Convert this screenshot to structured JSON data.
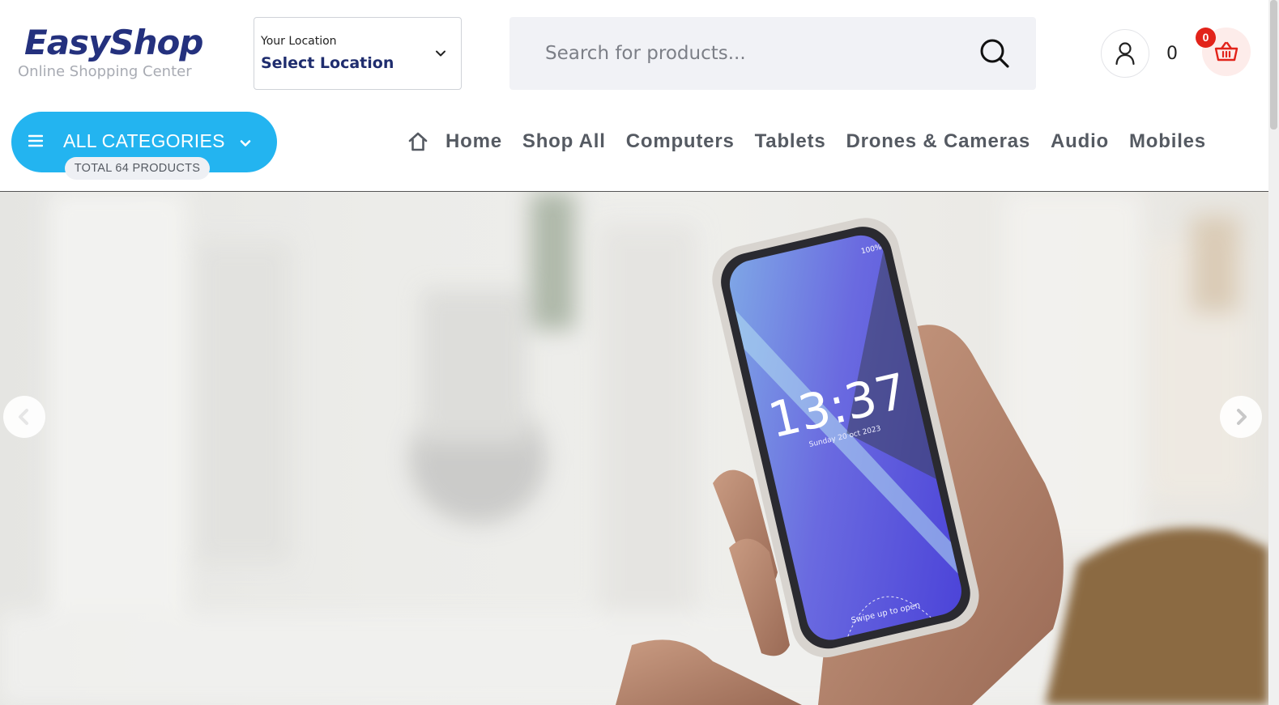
{
  "brand": {
    "name": "EasyShop",
    "tagline": "Online Shopping Center"
  },
  "location": {
    "label": "Your Location",
    "value": "Select Location",
    "icon": "chevron-down-icon"
  },
  "search": {
    "placeholder": "Search for products...",
    "icon": "search-icon"
  },
  "account": {
    "icon": "user-icon"
  },
  "cart": {
    "total": "0",
    "count": "0",
    "icon": "basket-icon"
  },
  "categories": {
    "label": "ALL CATEGORIES",
    "count_label": "TOTAL 64 PRODUCTS",
    "icon": "hamburger-icon"
  },
  "nav": {
    "home_icon": "home-icon",
    "items": [
      {
        "label": "Home"
      },
      {
        "label": "Shop All"
      },
      {
        "label": "Computers"
      },
      {
        "label": "Tablets"
      },
      {
        "label": "Drones & Cameras"
      },
      {
        "label": "Audio"
      },
      {
        "label": "Mobiles"
      }
    ]
  },
  "hero": {
    "phone_time": "13:37",
    "phone_date": "Sunday 20 oct 2023",
    "phone_battery": "100%",
    "phone_hint": "Swipe up to open",
    "prev_icon": "chevron-left-icon",
    "next_icon": "chevron-right-icon"
  },
  "colors": {
    "brand": "#24317e",
    "accent": "#23b4f0",
    "badge": "#e2231a",
    "nav_text": "#555a62"
  }
}
